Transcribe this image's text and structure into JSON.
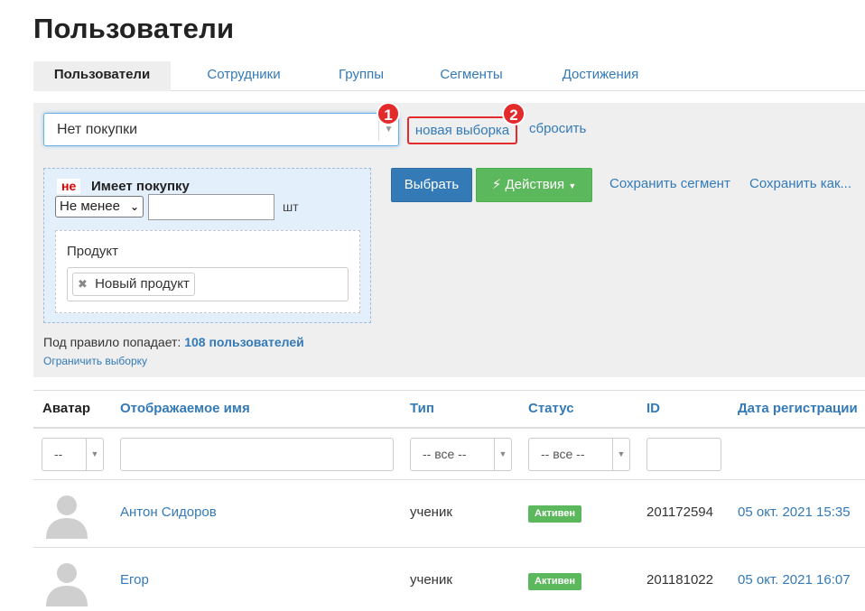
{
  "page": {
    "title": "Пользователи"
  },
  "tabs": [
    {
      "label": "Пользователи",
      "active": true
    },
    {
      "label": "Сотрудники"
    },
    {
      "label": "Группы"
    },
    {
      "label": "Сегменты"
    },
    {
      "label": "Достижения"
    }
  ],
  "filter": {
    "rule_select_value": "Нет покупки",
    "new_selection_label": "новая выборка",
    "reset_label": "сбросить",
    "badge_1": "1",
    "badge_2": "2",
    "rule": {
      "negation": "не",
      "name": "Имеет покупку",
      "condition_value": "Не менее",
      "quantity_value": "",
      "unit": "шт",
      "product_label": "Продукт",
      "product_tag": "Новый продукт"
    },
    "select_button": "Выбрать",
    "actions_button": "Действия",
    "save_segment": "Сохранить сегмент",
    "save_as": "Сохранить как...",
    "summary_prefix": "Под правило попадает:",
    "summary_count": "108 пользователей",
    "limit_link": "Ограничить выборку"
  },
  "table": {
    "headers": {
      "avatar": "Аватар",
      "name": "Отображаемое имя",
      "type": "Тип",
      "status": "Статус",
      "id": "ID",
      "reg_date": "Дата регистрации"
    },
    "filters": {
      "avatar": "--",
      "name": "",
      "type": "-- все --",
      "status": "-- все --",
      "id": ""
    },
    "rows": [
      {
        "name": "Антон Сидоров",
        "type": "ученик",
        "status": "Активен",
        "id": "201172594",
        "reg_date": "05 окт. 2021 15:35"
      },
      {
        "name": "Егор",
        "type": "ученик",
        "status": "Активен",
        "id": "201181022",
        "reg_date": "05 окт. 2021 16:07"
      }
    ]
  },
  "colors": {
    "link": "#337ab7",
    "primary": "#337ab7",
    "success": "#5cb85c",
    "highlight": "#e32b2b"
  },
  "icons": {
    "select_arrow": "triangle-down-icon",
    "actions": "lightning-icon",
    "remove_tag": "close-icon",
    "avatar": "user-silhouette-icon"
  }
}
